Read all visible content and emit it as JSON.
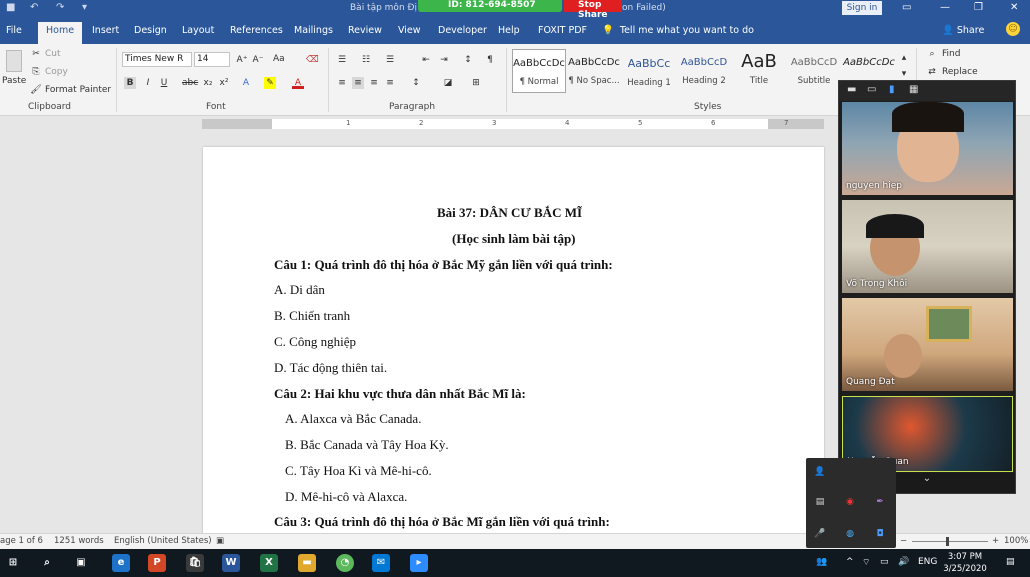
{
  "window": {
    "doc_title": "Bài tập môn Đị",
    "zoom_meeting_id": "ID: 812-694-8507",
    "zoom_stop_share": "Stop Share",
    "zoom_status_fragment": "on Failed)",
    "sign_in": "Sign in"
  },
  "tabs": [
    "File",
    "Home",
    "Insert",
    "Design",
    "Layout",
    "References",
    "Mailings",
    "Review",
    "View",
    "Developer",
    "Help",
    "FOXIT PDF"
  ],
  "tell_me": "Tell me what you want to do",
  "share": "Share",
  "ribbon": {
    "clipboard": {
      "label": "Clipboard",
      "paste": "Paste",
      "cut": "Cut",
      "copy": "Copy",
      "format_painter": "Format Painter"
    },
    "font": {
      "label": "Font",
      "name": "Times New R",
      "size": "14",
      "aa": "Aa"
    },
    "paragraph": {
      "label": "Paragraph"
    },
    "styles": {
      "label": "Styles",
      "items": [
        {
          "sample": "AaBbCcDc",
          "name": "¶ Normal"
        },
        {
          "sample": "AaBbCcDc",
          "name": "¶ No Spac..."
        },
        {
          "sample": "AaBbCc",
          "name": "Heading 1"
        },
        {
          "sample": "AaBbCcD",
          "name": "Heading 2"
        },
        {
          "sample": "AaB",
          "name": "Title"
        },
        {
          "sample": "AaBbCcD",
          "name": "Subtitle"
        },
        {
          "sample": "AaBbCcDc",
          "name": ""
        }
      ]
    },
    "editing": {
      "find": "Find",
      "replace": "Replace"
    }
  },
  "ruler_numbers": [
    "1",
    "2",
    "3",
    "4",
    "5",
    "6",
    "7"
  ],
  "document": {
    "title": "Bài 37:   DÂN CƯ BẮC MĨ",
    "subtitle": "(Học sinh làm bài tập)",
    "q1": "Câu 1: Quá trình đô thị hóa ở Bắc Mỹ gắn liền với quá trình:",
    "q1_options": [
      "A. Di dân",
      "B. Chiến tranh",
      "C. Công nghiệp",
      "D. Tác động thiên tai."
    ],
    "q2": "Câu 2: Hai khu vực thưa dân nhất Bắc Mĩ là:",
    "q2_options": [
      "A. Alaxca và Bắc Canada.",
      "B. Bắc Canada và Tây Hoa Kỳ.",
      "C. Tây Hoa Kì và Mê-hi-cô.",
      "D. Mê-hi-cô và Alaxca."
    ],
    "q3": "Câu 3: Quá trình đô thị hóa ở Bắc Mĩ gắn liền với quá trình:"
  },
  "status": {
    "page": "age 1 of 6",
    "words": "1251 words",
    "language": "English (United States)",
    "zoom": "100%"
  },
  "zoom_participants": [
    "nguyen hiep",
    "Võ Trọng Khôi",
    "Quang Đạt",
    "Nguyễn Quan"
  ],
  "taskbar": {
    "lang": "ENG",
    "time": "3:07 PM",
    "date": "3/25/2020"
  },
  "colors": {
    "word_blue": "#2b579a",
    "zoom_green": "#3cb64a",
    "zoom_red": "#e02020"
  }
}
